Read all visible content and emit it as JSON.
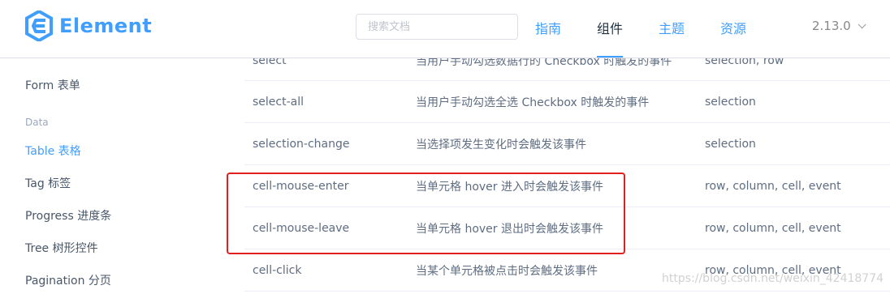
{
  "brand": {
    "name": "Element",
    "color": "#409EFF"
  },
  "search": {
    "placeholder": "搜索文档"
  },
  "nav": {
    "guide": "指南",
    "component": "组件",
    "theme": "主题",
    "resource": "资源"
  },
  "version": {
    "label": "2.13.0"
  },
  "sidebar": {
    "items": [
      {
        "label": "Form 表单"
      },
      {
        "label": "Table 表格"
      },
      {
        "label": "Tag 标签"
      },
      {
        "label": "Progress 进度条"
      },
      {
        "label": "Tree 树形控件"
      },
      {
        "label": "Pagination 分页"
      }
    ],
    "group_data": "Data",
    "active_item": "Table 表格"
  },
  "events": {
    "rows": [
      {
        "name": "select",
        "desc": "当用户手动勾选数据行的 Checkbox 时触发的事件",
        "params": "selection, row"
      },
      {
        "name": "select-all",
        "desc": "当用户手动勾选全选 Checkbox 时触发的事件",
        "params": "selection"
      },
      {
        "name": "selection-change",
        "desc": "当选择项发生变化时会触发该事件",
        "params": "selection"
      },
      {
        "name": "cell-mouse-enter",
        "desc": "当单元格 hover 进入时会触发该事件",
        "params": "row, column, cell, event"
      },
      {
        "name": "cell-mouse-leave",
        "desc": "当单元格 hover 退出时会触发该事件",
        "params": "row, column, cell, event"
      },
      {
        "name": "cell-click",
        "desc": "当某个单元格被点击时会触发该事件",
        "params": "row, column, cell, event"
      }
    ]
  },
  "annotation": {
    "highlight_color": "#e02020"
  },
  "watermark": "https://blog.csdn.net/weixin_42418774"
}
